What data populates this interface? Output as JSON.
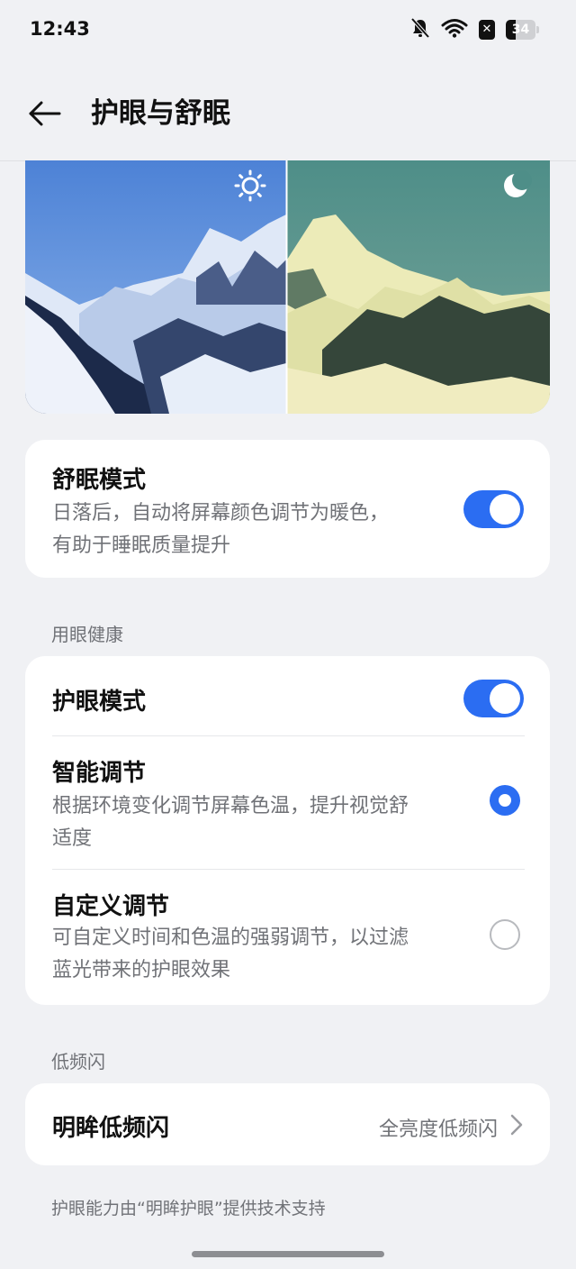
{
  "status_bar": {
    "time": "12:43",
    "battery_level": "34",
    "icons": [
      "bell-off-icon",
      "wifi-icon",
      "x-box-icon",
      "battery-icon"
    ]
  },
  "header": {
    "title": "护眼与舒眠",
    "back_icon": "arrow-left-icon"
  },
  "hero": {
    "day_icon": "sun-icon",
    "night_icon": "moon-icon"
  },
  "sleep_card": {
    "title": "舒眠模式",
    "desc_line1": "日落后，自动将屏幕颜色调节为暖色，",
    "desc_line2": "有助于睡眠质量提升",
    "toggle_on": true
  },
  "eye_health": {
    "section_label": "用眼健康",
    "eye_mode": {
      "title": "护眼模式",
      "toggle_on": true
    },
    "smart": {
      "title": "智能调节",
      "desc_line1": "根据环境变化调节屏幕色温，提升视觉舒",
      "desc_line2": "适度",
      "selected": true
    },
    "custom": {
      "title": "自定义调节",
      "desc_line1": "可自定义时间和色温的强弱调节，以过滤",
      "desc_line2": "蓝光带来的护眼效果",
      "selected": false
    }
  },
  "low_flicker": {
    "section_label": "低频闪",
    "row_title": "明眸低频闪",
    "row_value": "全亮度低频闪",
    "chevron_icon": "chevron-right-icon"
  },
  "footer_note": "护眼能力由“明眸护眼”提供技术支持",
  "colors": {
    "accent": "#2b6df2",
    "background": "#f0f1f4",
    "card": "#ffffff",
    "secondary_text": "#707277"
  }
}
